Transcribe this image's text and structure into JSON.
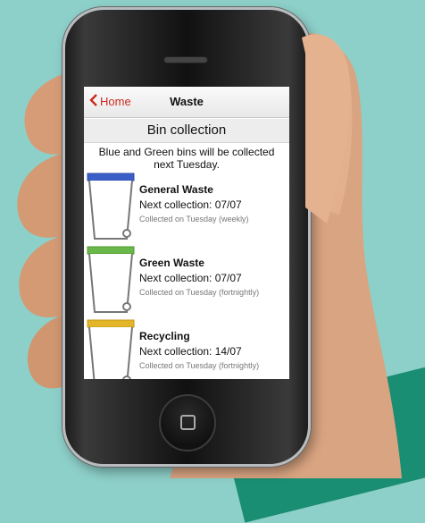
{
  "navbar": {
    "back_label": "Home",
    "title": "Waste"
  },
  "section": {
    "title": "Bin collection"
  },
  "note": "Blue and Green bins will be collected next Tuesday.",
  "bins": [
    {
      "name": "General Waste",
      "next": "Next collection: 07/07",
      "collected": "Collected on Tuesday (weekly)",
      "lid_color": "#3b5fc8"
    },
    {
      "name": "Green Waste",
      "next": "Next collection: 07/07",
      "collected": "Collected on Tuesday (fortnightly)",
      "lid_color": "#6bb84a"
    },
    {
      "name": "Recycling",
      "next": "Next collection: 14/07",
      "collected": "Collected on Tuesday (fortnightly)",
      "lid_color": "#e3b62a"
    }
  ],
  "colors": {
    "accent": "#cc2a20",
    "background": "#8dd0c9"
  }
}
